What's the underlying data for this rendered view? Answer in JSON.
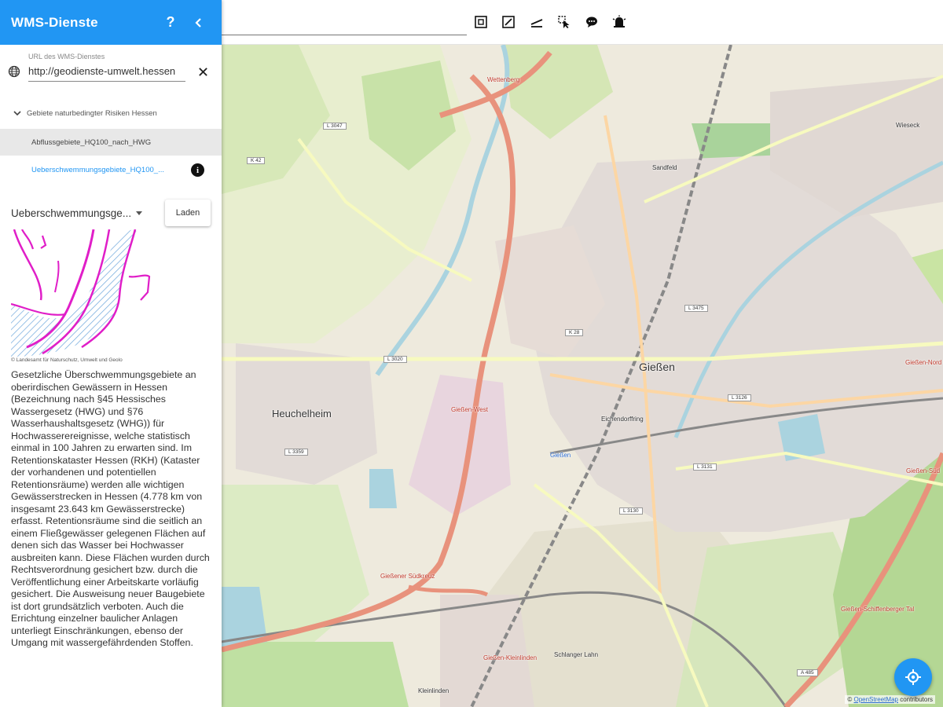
{
  "sidebar": {
    "title": "WMS-Dienste",
    "help_label": "?",
    "url_label": "URL des WMS-Dienstes",
    "url_value": "http://geodienste-umwelt.hessen",
    "group_label": "Gebiete naturbedingter Risiken Hessen",
    "layers": [
      {
        "label": "Abflussgebiete_HQ100_nach_HWG"
      },
      {
        "label": "Ueberschwemmungsgebiete_HQ100_..."
      }
    ],
    "info_label": "i",
    "style_select_value": "Ueberschwemmungsge...",
    "load_button": "Laden",
    "legend_credit": "© Landesamt für Naturschutz, Umwelt und Geolo",
    "description": "Gesetzliche Überschwemmungsgebiete an oberirdischen Gewässern in Hessen (Bezeichnung nach §45 Hessisches Wassergesetz (HWG) und §76 Wasserhaushaltsgesetz (WHG)) für Hochwasserereignisse, welche statistisch einmal in 100 Jahren zu erwarten sind. Im Retentionskataster Hessen (RKH) (Kataster der vorhandenen und potentiellen Retentionsräume) werden alle wichtigen Gewässerstrecken in Hessen (4.778 km von insgesamt 23.643 km Gewässerstrecke) erfasst. Retentionsräume sind die seitlich an einem Fließgewässer gelegenen Flächen auf denen sich das Wasser bei Hochwasser ausbreiten kann. Diese Flächen wurden durch Rechtsverordnung gesichert bzw. durch die Veröffentlichung einer Arbeitskarte vorläufig gesichert. Die Ausweisung neuer Baugebiete ist dort grundsätzlich verboten. Auch die Errichtung einzelner baulicher Anlagen unterliegt Einschränkungen, ebenso der Umgang mit wassergefährdenden Stoffen."
  },
  "toolbar": {
    "icons": [
      "select-area-icon",
      "edit-icon",
      "measure-icon",
      "pointer-select-icon",
      "comment-icon",
      "alarm-icon"
    ]
  },
  "map": {
    "labels": {
      "giessen": "Gießen",
      "heuchelheim": "Heuchelheim",
      "wieseck": "Wieseck",
      "sandfeld": "Sandfeld",
      "eichendorff": "Eichendorffring",
      "schlanger_lahn": "Schlanger Lahn",
      "kleinlinden": "Kleinlinden",
      "giessen_bf": "Gießen",
      "giessen_nord": "Gießen-Nord",
      "giessen_west": "Gießen-West",
      "giessen_sued": "Gießen-Süd",
      "giessen_kleinlinden": "Gießen-Kleinlinden",
      "wettenberg": "Wettenberg",
      "dreieck": "Gießener Südkreuz",
      "giessen_schiffenberger": "Gießen-Schiffenberger Tal"
    },
    "road_refs": [
      "L 3047",
      "K 42",
      "L 3020",
      "K 28",
      "L 3475",
      "L 3126",
      "L 3131",
      "L 3130",
      "L 3359",
      "A 485"
    ]
  },
  "attribution": {
    "prefix": "©",
    "link": "OpenStreetMap",
    "suffix": "contributors"
  },
  "colors": {
    "accent": "#2196f3",
    "legend_magenta": "#e01ec8",
    "motorway": "#e8927c"
  }
}
